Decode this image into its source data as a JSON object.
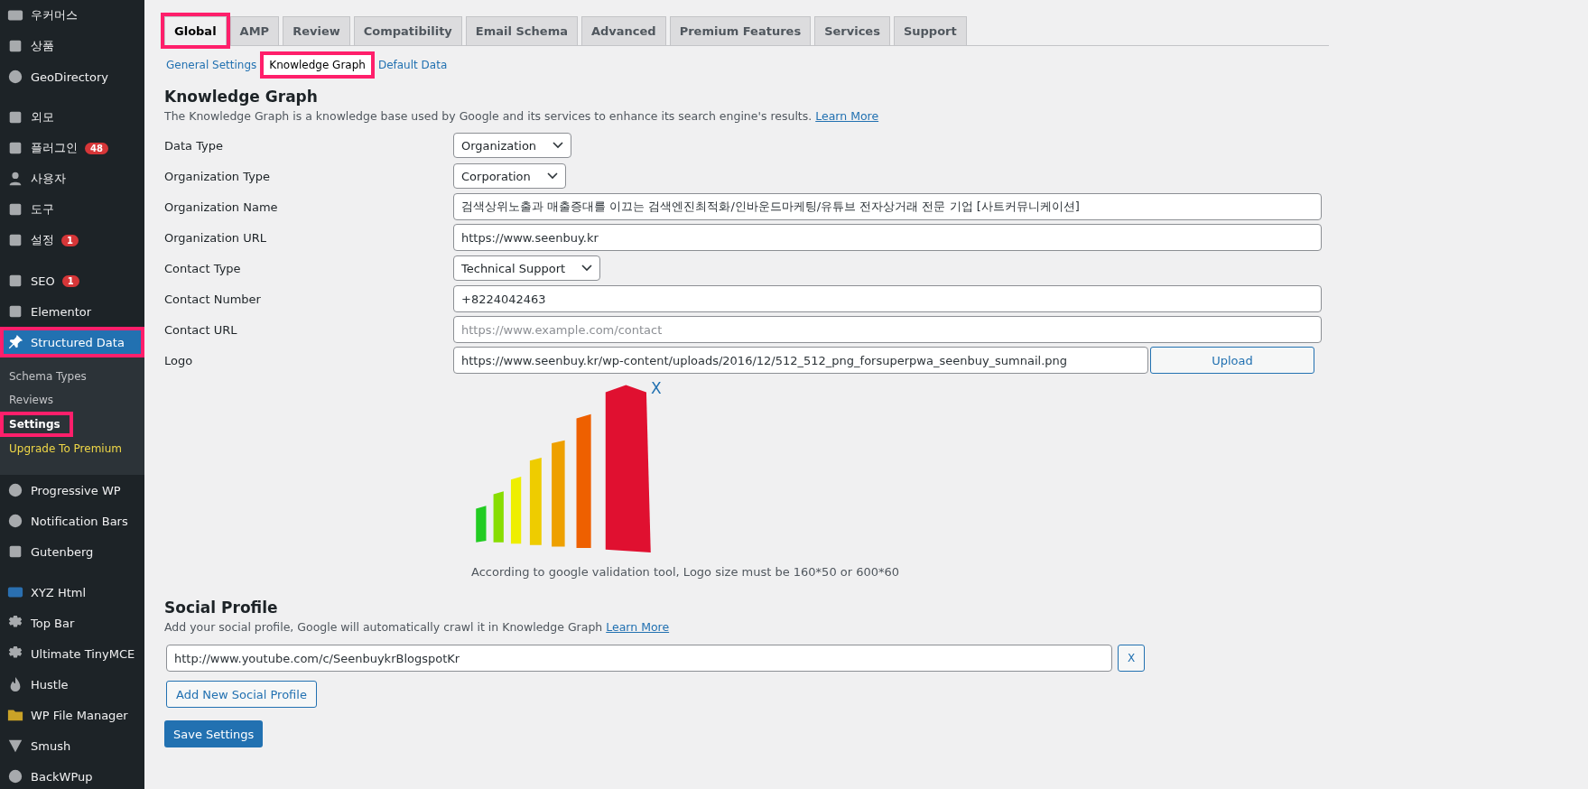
{
  "sidebar": {
    "groups": [
      [
        {
          "label": "우커머스",
          "selected": false,
          "highlighted": false
        },
        {
          "label": "상품",
          "selected": false,
          "highlighted": false
        },
        {
          "label": "GeoDirectory",
          "selected": false,
          "highlighted": false
        }
      ],
      [
        {
          "label": "외모",
          "selected": false,
          "highlighted": false
        },
        {
          "label": "플러그인",
          "badge": "48",
          "selected": false,
          "highlighted": false
        },
        {
          "label": "사용자",
          "selected": false,
          "highlighted": false
        },
        {
          "label": "도구",
          "selected": false,
          "highlighted": false
        },
        {
          "label": "설정",
          "badge": "1",
          "selected": false,
          "highlighted": false
        }
      ],
      [
        {
          "label": "SEO",
          "badge": "1",
          "selected": false,
          "highlighted": false
        },
        {
          "label": "Elementor",
          "selected": false,
          "highlighted": false
        },
        {
          "label": "Structured Data",
          "selected": true,
          "highlighted": true,
          "children": [
            {
              "label": "Schema Types",
              "selected": false,
              "highlighted": false,
              "kind": "normal"
            },
            {
              "label": "Reviews",
              "selected": false,
              "highlighted": false,
              "kind": "normal"
            },
            {
              "label": "Settings",
              "selected": true,
              "highlighted": true,
              "kind": "normal"
            },
            {
              "label": "Upgrade To Premium",
              "selected": false,
              "highlighted": false,
              "kind": "promo"
            }
          ]
        },
        {
          "label": "Progressive WP",
          "selected": false,
          "highlighted": false
        },
        {
          "label": "Notification Bars",
          "selected": false,
          "highlighted": false
        },
        {
          "label": "Gutenberg",
          "selected": false,
          "highlighted": false
        }
      ],
      [
        {
          "label": "XYZ Html",
          "selected": false,
          "highlighted": false
        },
        {
          "label": "Top Bar",
          "selected": false,
          "highlighted": false
        },
        {
          "label": "Ultimate TinyMCE",
          "selected": false,
          "highlighted": false
        },
        {
          "label": "Hustle",
          "selected": false,
          "highlighted": false
        },
        {
          "label": "WP File Manager",
          "selected": false,
          "highlighted": false
        },
        {
          "label": "Smush",
          "selected": false,
          "highlighted": false
        },
        {
          "label": "BackWPup",
          "selected": false,
          "highlighted": false
        }
      ]
    ]
  },
  "tabs": [
    {
      "label": "Global",
      "selected": true,
      "highlighted": true
    },
    {
      "label": "AMP",
      "selected": false,
      "highlighted": false
    },
    {
      "label": "Review",
      "selected": false,
      "highlighted": false
    },
    {
      "label": "Compatibility",
      "selected": false,
      "highlighted": false
    },
    {
      "label": "Email Schema",
      "selected": false,
      "highlighted": false
    },
    {
      "label": "Advanced",
      "selected": false,
      "highlighted": false
    },
    {
      "label": "Premium Features",
      "selected": false,
      "highlighted": false
    },
    {
      "label": "Services",
      "selected": false,
      "highlighted": false
    },
    {
      "label": "Support",
      "selected": false,
      "highlighted": false
    }
  ],
  "subtabs": [
    {
      "label": "General Settings",
      "selected": false,
      "highlighted": false
    },
    {
      "label": "Knowledge Graph",
      "selected": true,
      "highlighted": true
    },
    {
      "label": "Default Data",
      "selected": false,
      "highlighted": false
    }
  ],
  "knowledge_graph": {
    "title": "Knowledge Graph",
    "description": "The Knowledge Graph is a knowledge base used by Google and its services to enhance its search engine's results.",
    "link": "Learn More",
    "fields": [
      {
        "label": "Data Type",
        "kind": "select",
        "value": "Organization"
      },
      {
        "label": "Organization Type",
        "kind": "select",
        "value": "Corporation"
      },
      {
        "label": "Organization Name",
        "kind": "text",
        "value": "검색상위노출과 매출증대를 이끄는 검색엔진최적화/인바운드마케팅/유튜브 전자상거래 전문 기업 [사트커뮤니케이션]"
      },
      {
        "label": "Organization URL",
        "kind": "text",
        "value": "https://www.seenbuy.kr"
      },
      {
        "label": "Contact Type",
        "kind": "select",
        "value": "Technical Support"
      },
      {
        "label": "Contact Number",
        "kind": "text",
        "value": "+8224042463"
      },
      {
        "label": "Contact URL",
        "kind": "text",
        "placeholder": "https://www.example.com/contact"
      },
      {
        "label": "Logo",
        "kind": "upload",
        "value": "https://www.seenbuy.kr/wp-content/uploads/2016/12/512_512_png_forsuperpwa_seenbuy_sumnail.png",
        "button": "Upload"
      }
    ],
    "logo_remove": "X",
    "logo_note": "According to google validation tool, Logo size must be 160*50 or 600*60"
  },
  "social_profile": {
    "title": "Social Profile",
    "description": "Add your social profile, Google will automatically crawl it in Knowledge Graph",
    "link": "Learn More",
    "profiles": [
      {
        "value": "http://www.youtube.com/c/SeenbuykrBlogspotKr",
        "remove": "X"
      }
    ],
    "add_button": "Add New Social Profile"
  },
  "save_button": "Save Settings"
}
